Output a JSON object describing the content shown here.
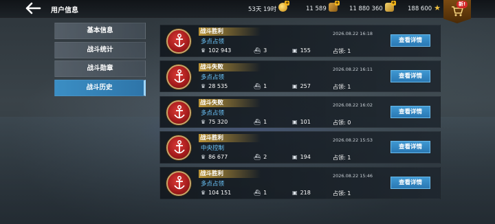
{
  "header": {
    "title": "用户信息",
    "resources": [
      {
        "value": "53天 19时",
        "icon": "gold-timer-icon"
      },
      {
        "value": "11 589",
        "icon": "crate-icon"
      },
      {
        "value": "11 880 360",
        "icon": "silver-bars-icon"
      },
      {
        "value": "188 600",
        "icon": "star-icon"
      }
    ],
    "shop_badge": "新!"
  },
  "sidebar": {
    "items": [
      {
        "label": "基本信息",
        "active": false
      },
      {
        "label": "战斗统计",
        "active": false
      },
      {
        "label": "战斗勋章",
        "active": false
      },
      {
        "label": "战斗历史",
        "active": true
      }
    ]
  },
  "battles": [
    {
      "result": "战斗胜利",
      "mode": "多点占领",
      "score": "102 943",
      "ships": "3",
      "boxes": "155",
      "capture": "占领: 1",
      "date": "2026.08.22 16:18",
      "button": "查看详情"
    },
    {
      "result": "战斗失败",
      "mode": "多点占领",
      "score": "28 535",
      "ships": "1",
      "boxes": "257",
      "capture": "占领: 1",
      "date": "2026.08.22 16:11",
      "button": "查看详情"
    },
    {
      "result": "战斗失败",
      "mode": "多点占领",
      "score": "75 320",
      "ships": "1",
      "boxes": "101",
      "capture": "占领: 0",
      "date": "2026.08.22 16:02",
      "button": "查看详情"
    },
    {
      "result": "战斗胜利",
      "mode": "中央控制",
      "score": "86 677",
      "ships": "2",
      "boxes": "194",
      "capture": "占领: 1",
      "date": "2026.08.22 15:53",
      "button": "查看详情"
    },
    {
      "result": "战斗胜利",
      "mode": "多点占领",
      "score": "104 151",
      "ships": "1",
      "boxes": "218",
      "capture": "占领: 1",
      "date": "2026.08.22 15:46",
      "button": "查看详情"
    }
  ],
  "colors": {
    "accent": "#2e85c2",
    "mode_text": "#6ec9ff",
    "result_gold": "#d7a83a",
    "emblem_red": "#b22222"
  }
}
